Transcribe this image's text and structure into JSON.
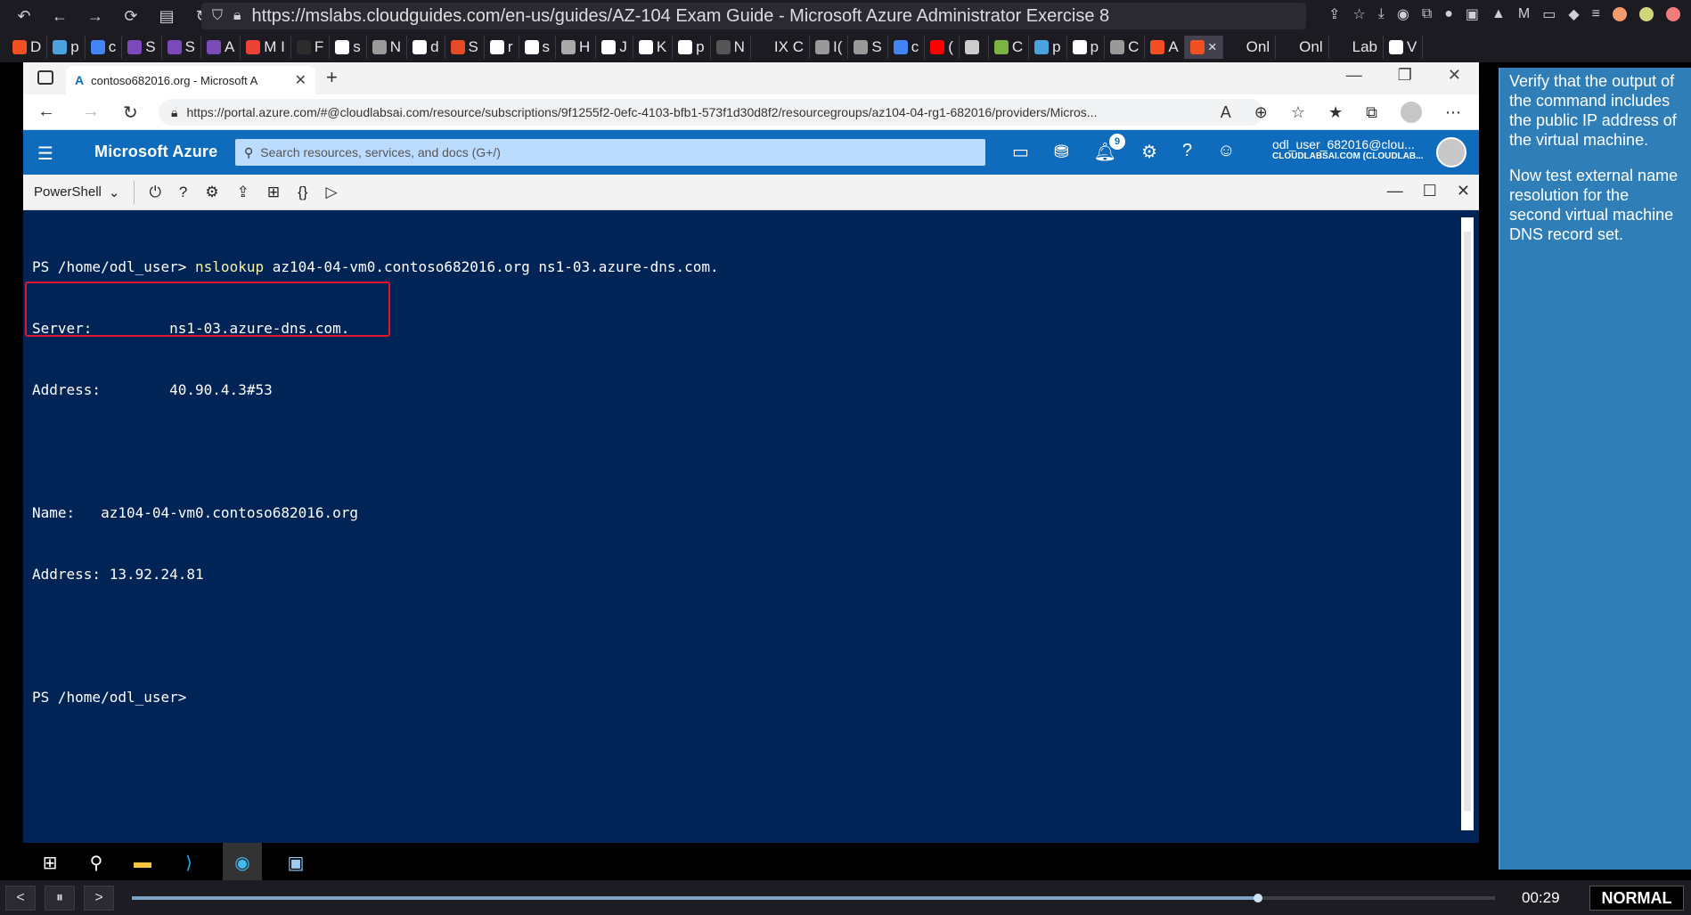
{
  "outer_browser": {
    "url_prefix": "https://mslabs.",
    "url_domain": "cloudguides.com",
    "url_suffix": "/en-us/guides/AZ-104 Exam Guide - Microsoft Azure Administrator Exercise 8"
  },
  "bookmarks": [
    {
      "label": "D",
      "color": "#f25022"
    },
    {
      "label": "p",
      "color": "#4aa3df"
    },
    {
      "label": "c",
      "color": "#4285f4"
    },
    {
      "label": "S",
      "color": "#7b4ab8"
    },
    {
      "label": "S",
      "color": "#7b4ab8"
    },
    {
      "label": "A",
      "color": "#7b4ab8"
    },
    {
      "label": "M I",
      "color": "#ea4335"
    },
    {
      "label": "F",
      "color": "#2b2b2b"
    },
    {
      "label": "s",
      "color": "#ffffff"
    },
    {
      "label": "N",
      "color": "#9a9a9a"
    },
    {
      "label": "d",
      "color": "#ffffff"
    },
    {
      "label": "S",
      "color": "#e34c26"
    },
    {
      "label": "r",
      "color": "#ffffff"
    },
    {
      "label": "s",
      "color": "#ffffff"
    },
    {
      "label": "H",
      "color": "#aaaaaa"
    },
    {
      "label": "J",
      "color": "#ffffff"
    },
    {
      "label": "K",
      "color": "#ffffff"
    },
    {
      "label": "p",
      "color": "#ffffff"
    },
    {
      "label": "N",
      "color": "#555555"
    },
    {
      "label": "IX C",
      "color": "#1c1b22"
    },
    {
      "label": "I(",
      "color": "#999999"
    },
    {
      "label": "S",
      "color": "#999999"
    },
    {
      "label": "c",
      "color": "#4285f4"
    },
    {
      "label": "(",
      "color": "#ff0000"
    },
    {
      "label": "",
      "color": "#cccccc"
    },
    {
      "label": "C",
      "color": "#7cb342"
    },
    {
      "label": "p",
      "color": "#4aa3df"
    },
    {
      "label": "p",
      "color": "#ffffff"
    },
    {
      "label": "C",
      "color": "#999999"
    },
    {
      "label": "A",
      "color": "#f25022"
    },
    {
      "label": "×",
      "color": "#f25022",
      "active": true
    },
    {
      "label": "Onl",
      "color": "#1c1b22"
    },
    {
      "label": "Onl",
      "color": "#1c1b22"
    },
    {
      "label": "Lab",
      "color": "#1c1b22"
    },
    {
      "label": "V",
      "color": "#ffffff"
    }
  ],
  "edge": {
    "tab_title": "contoso682016.org - Microsoft A",
    "url": "https://portal.azure.com/#@cloudlabsai.com/resource/subscriptions/9f1255f2-0efc-4103-bfb1-573f1d30d8f2/resourcegroups/az104-04-rg1-682016/providers/Micros..."
  },
  "azure": {
    "brand": "Microsoft Azure",
    "search_placeholder": "Search resources, services, and docs (G+/)",
    "notifications": "9",
    "user_name": "odl_user_682016@clou...",
    "user_org": "CLOUDLABSAI.COM (CLOUDLAB..."
  },
  "shell": {
    "type": "PowerShell"
  },
  "terminal": {
    "prompt1": "PS /home/odl_user> ",
    "command": "nslookup",
    "args": " az104-04-vm0.contoso682016.org ns1-03.azure-dns.com.",
    "server_line": "Server:         ns1-03.azure-dns.com.",
    "address_line": "Address:        40.90.4.3#53",
    "name_line": "Name:   az104-04-vm0.contoso682016.org",
    "result_address_line": "Address: 13.92.24.81",
    "prompt2": "PS /home/odl_user>"
  },
  "side_note": {
    "p1": "Verify that the output of the command includes the public IP address of the virtual machine.",
    "p2": "Now test external name resolution for the second virtual machine DNS record set."
  },
  "player": {
    "time": "00:29",
    "mode": "NORMAL",
    "progress": 0.826
  }
}
